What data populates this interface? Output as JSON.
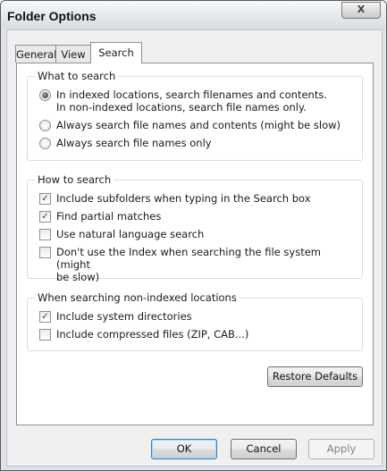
{
  "window": {
    "title": "Folder Options",
    "close_glyph": "X"
  },
  "tabs": [
    {
      "label": "General",
      "active": false
    },
    {
      "label": "View",
      "active": false
    },
    {
      "label": "Search",
      "active": true
    }
  ],
  "what_to_search": {
    "legend": "What to search",
    "options": [
      {
        "line1": "In indexed locations, search filenames and contents.",
        "line2": "In non-indexed locations, search file names only.",
        "selected": true
      },
      {
        "line1": "Always search file names and contents (might be slow)",
        "selected": false
      },
      {
        "line1": "Always search file names only",
        "selected": false
      }
    ]
  },
  "how_to_search": {
    "legend": "How to search",
    "options": [
      {
        "line1": "Include subfolders when typing in the Search box",
        "checked": true
      },
      {
        "line1": "Find partial matches",
        "checked": true
      },
      {
        "line1": "Use natural language search",
        "checked": false
      },
      {
        "line1": "Don't use the Index when searching the file system (might",
        "line2": "be slow)",
        "checked": false
      }
    ]
  },
  "non_indexed": {
    "legend": "When searching non-indexed locations",
    "options": [
      {
        "line1": "Include system directories",
        "checked": true
      },
      {
        "line1": "Include compressed files (ZIP, CAB...)",
        "checked": false
      }
    ]
  },
  "check_glyph": "✓",
  "buttons": {
    "restore_defaults": "Restore Defaults",
    "ok": "OK",
    "cancel": "Cancel",
    "apply": "Apply"
  }
}
